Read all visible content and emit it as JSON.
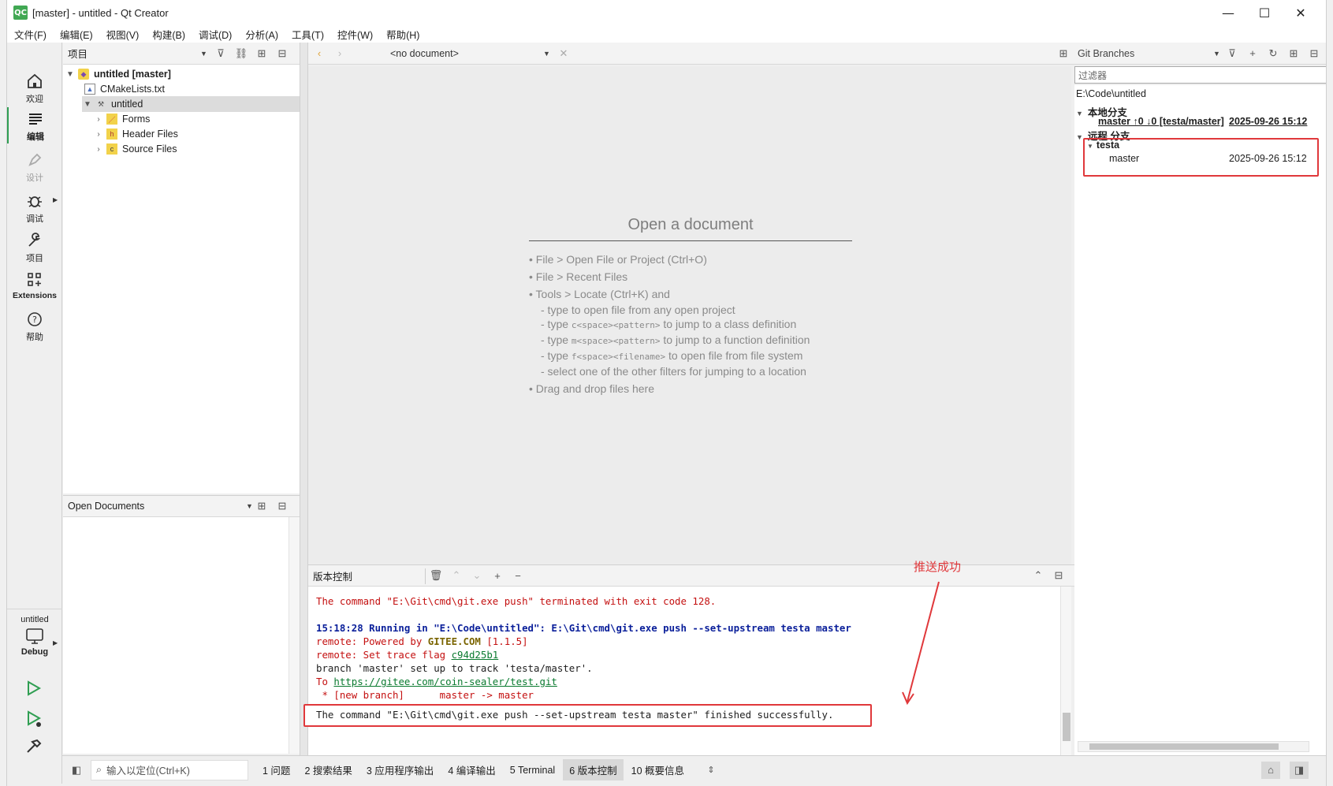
{
  "window": {
    "title": "[master] - untitled - Qt Creator",
    "logo": "QC"
  },
  "menu": [
    "文件(F)",
    "编辑(E)",
    "视图(V)",
    "构建(B)",
    "调试(D)",
    "分析(A)",
    "工具(T)",
    "控件(W)",
    "帮助(H)"
  ],
  "modes": {
    "welcome": "欢迎",
    "edit": "编辑",
    "design": "设计",
    "debug": "调试",
    "project": "项目",
    "extensions": "Extensions",
    "help": "帮助"
  },
  "kit": {
    "project": "untitled",
    "config": "Debug"
  },
  "projects_pane": {
    "title": "项目",
    "tree": {
      "root": "untitled [master]",
      "cmake": "CMakeLists.txt",
      "target": "untitled",
      "forms": "Forms",
      "headers": "Header Files",
      "sources": "Source Files"
    }
  },
  "open_docs": {
    "title": "Open Documents"
  },
  "editor": {
    "doc_selector": "<no document>",
    "welcome_title": "Open a document",
    "lines": [
      "• File > Open File or Project (Ctrl+O)",
      "• File > Recent Files",
      "• Tools > Locate (Ctrl+K) and",
      "- type to open file from any open project",
      "- type ",
      "c<space><pattern>",
      " to jump to a class definition",
      "- type ",
      "m<space><pattern>",
      " to jump to a function definition",
      "- type ",
      "f<space><filename>",
      " to open file from file system",
      "- select one of the other filters for jumping to a location",
      "• Drag and drop files here"
    ]
  },
  "vcs_pane": {
    "title": "版本控制",
    "log": {
      "l1": "The command \"E:\\Git\\cmd\\git.exe push\" terminated with exit code 128.",
      "l2": "15:18:28 Running in \"E:\\Code\\untitled\": E:\\Git\\cmd\\git.exe push --set-upstream testa master",
      "l3a": "remote: Powered by ",
      "l3b": "GITEE.COM",
      "l3c": " [1.1.5]",
      "l4a": "remote: Set trace flag ",
      "l4b": "c94d25b1",
      "l5": "branch 'master' set up to track 'testa/master'.",
      "l6a": "To ",
      "l6b": "https://gitee.com/coin-sealer/test.git",
      "l7": " * [new branch]      master -> master",
      "l8": "The command \"E:\\Git\\cmd\\git.exe push --set-upstream testa master\" finished successfully."
    },
    "annotation": "推送成功"
  },
  "git_branches": {
    "title": "Git Branches",
    "filter_placeholder": "过滤器",
    "repo_path": "E:\\Code\\untitled",
    "local_header": "本地分支",
    "local_branch": "master ↑0 ↓0 [testa/master]",
    "local_date": "2025-09-26 15:12",
    "remote_header": "远程 分支",
    "remote_name": "testa",
    "remote_branch": "master",
    "remote_date": "2025-09-26 15:12"
  },
  "statusbar": {
    "locate_placeholder": "输入以定位(Ctrl+K)",
    "tabs": [
      "1 问题",
      "2 搜索结果",
      "3 应用程序输出",
      "4 编译输出",
      "5 Terminal",
      "6 版本控制",
      "10 概要信息"
    ],
    "active_tab_index": 5
  },
  "colors": {
    "accent_green": "#41a853",
    "annotation_red": "#e0383b",
    "log_red": "#c41010",
    "log_blue": "#0a1f9a"
  }
}
